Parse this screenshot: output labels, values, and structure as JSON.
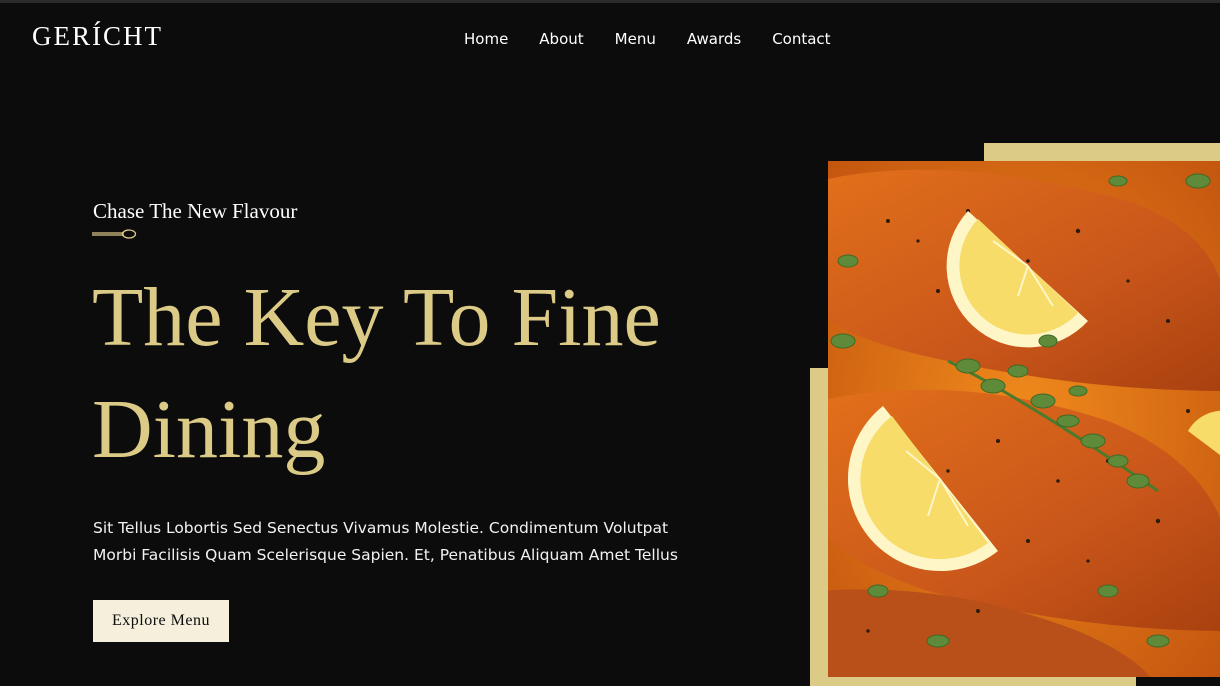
{
  "brand": {
    "logo": "GERÍCHT"
  },
  "nav": {
    "items": [
      {
        "label": "Home"
      },
      {
        "label": "About"
      },
      {
        "label": "Menu"
      },
      {
        "label": "Awards"
      },
      {
        "label": "Contact"
      }
    ]
  },
  "hero": {
    "subtitle": "Chase The New Flavour",
    "headline": "The Key To Fine Dining",
    "description": "Sit Tellus Lobortis Sed Senectus Vivamus Molestie. Condimentum Volutpat Morbi Facilisis Quam Scelerisque Sapien. Et, Penatibus Aliquam Amet Tellus",
    "cta_label": "Explore Menu",
    "image_subject": "salmon-with-lemon-and-herbs"
  },
  "colors": {
    "background": "#0c0c0c",
    "gold": "#dcca87",
    "cream": "#f5efdb",
    "white": "#ffffff"
  }
}
